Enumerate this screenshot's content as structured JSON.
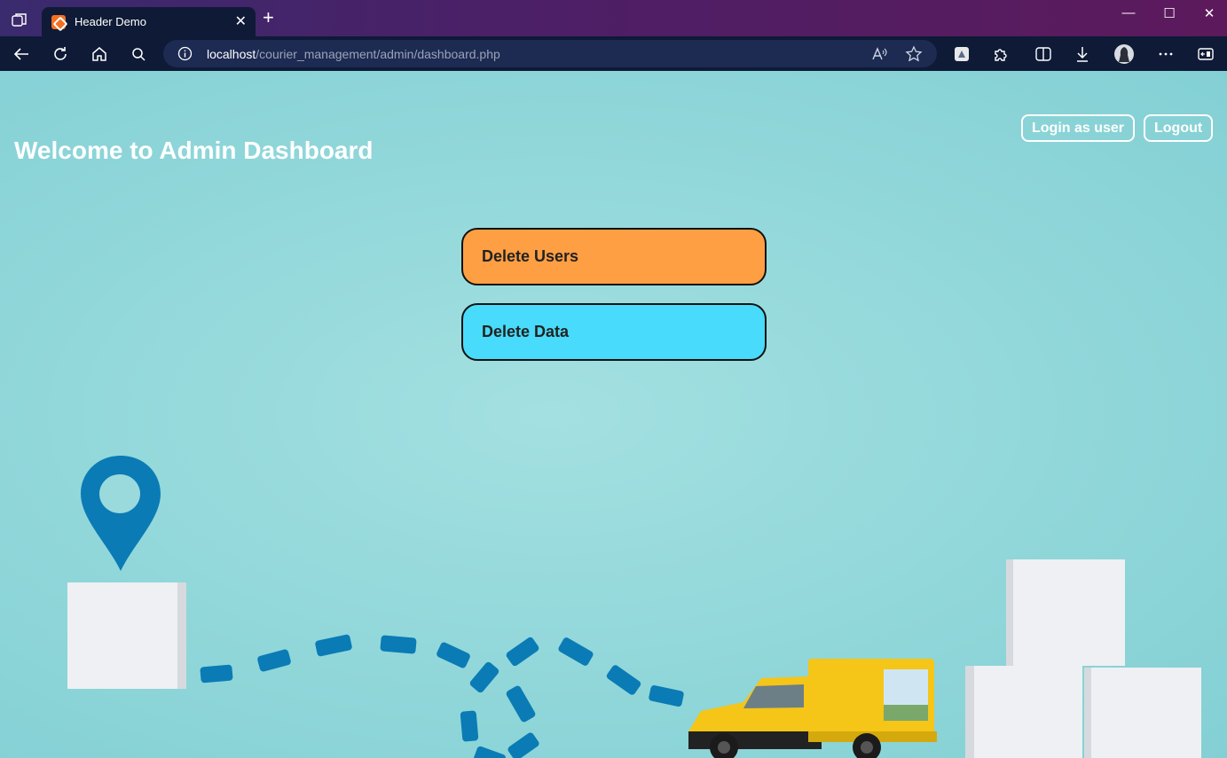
{
  "browser": {
    "tab_title": "Header Demo",
    "tab_close": "✕",
    "new_tab": "+",
    "window_controls": {
      "minimize": "—",
      "maximize": "☐",
      "close": "✕"
    },
    "address_host": "localhost",
    "address_path": "/courier_management/admin/dashboard.php",
    "icons": [
      "tab-actions-icon",
      "back-icon",
      "refresh-icon",
      "home-icon",
      "search-icon",
      "info-icon",
      "read-aloud-icon",
      "favorite-star-icon",
      "extension-icon",
      "puzzle-icon",
      "split-screen-icon",
      "download-icon",
      "profile-avatar",
      "more-icon",
      "sidebar-icon"
    ]
  },
  "page": {
    "title": "Welcome to Admin Dashboard",
    "header_buttons": {
      "login": "Login as user",
      "logout": "Logout"
    },
    "actions": {
      "delete_users": "Delete Users",
      "delete_data": "Delete Data"
    },
    "colors": {
      "orange": "#ff9f43",
      "cyan": "#48dbfb",
      "background": "#96d8da",
      "pin": "#0a7bb5",
      "van": "#f5c518"
    }
  }
}
